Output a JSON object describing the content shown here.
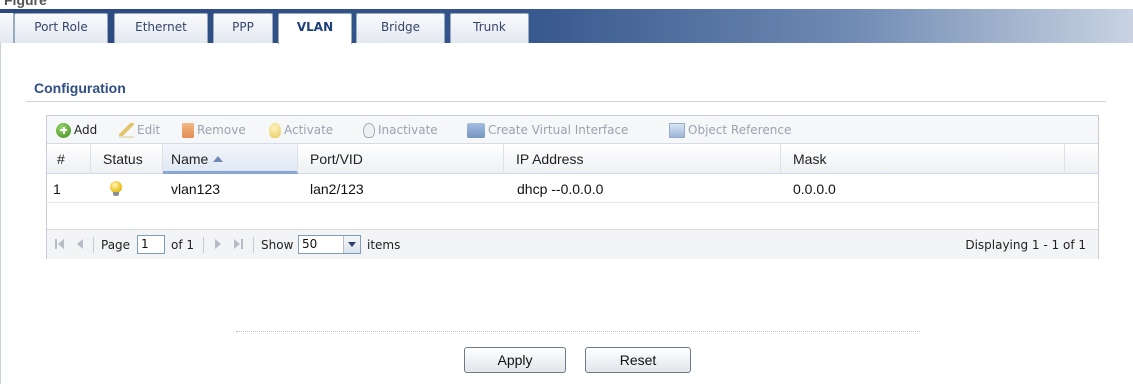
{
  "tabs": [
    {
      "label": "Port Role",
      "active": false
    },
    {
      "label": "Ethernet",
      "active": false
    },
    {
      "label": "PPP",
      "active": false
    },
    {
      "label": "VLAN",
      "active": true
    },
    {
      "label": "Bridge",
      "active": false
    },
    {
      "label": "Trunk",
      "active": false
    }
  ],
  "section": {
    "title": "Configuration"
  },
  "toolbar": {
    "add": "Add",
    "edit": "Edit",
    "remove": "Remove",
    "activate": "Activate",
    "inactivate": "Inactivate",
    "create_virtual_interface": "Create Virtual Interface",
    "object_reference": "Object Reference"
  },
  "table": {
    "headers": [
      "#",
      "Status",
      "Name",
      "Port/VID",
      "IP Address",
      "Mask"
    ],
    "sorted_column": "Name",
    "rows": [
      {
        "index": "1",
        "status_icon": "lightbulb-on-icon",
        "name": "vlan123",
        "port_vid": "lan2/123",
        "ip_address": "dhcp --0.0.0.0",
        "mask": "0.0.0.0"
      }
    ]
  },
  "pager": {
    "page_label": "Page",
    "page_value": "1",
    "of_label": "of 1",
    "show_label": "Show",
    "show_value": "50",
    "items_label": "items",
    "display_text": "Displaying 1 - 1 of 1"
  },
  "buttons": {
    "apply": "Apply",
    "reset": "Reset"
  },
  "colors": {
    "accent": "#2f4e83",
    "tabbar": "#2a4a7e"
  }
}
